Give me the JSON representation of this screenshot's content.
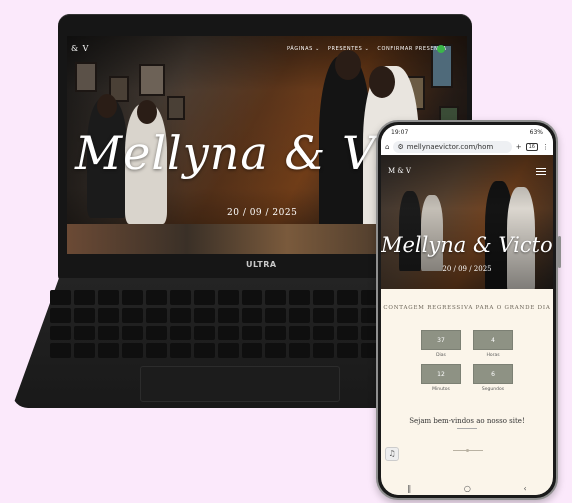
{
  "laptop": {
    "logo": "& V",
    "nav": [
      "PÁGINAS",
      "PRESENTES",
      "CONFIRMAR PRESENÇA"
    ],
    "hero_title": "Mellyna & Victor",
    "hero_date": "20 / 09 / 2025",
    "brand": "ULTRA"
  },
  "phone": {
    "status": {
      "time": "19:07",
      "battery": "63%"
    },
    "url": "mellynaevictor.com/hom",
    "tab_count": "16",
    "logo": "M & V",
    "hero_title": "Mellyna & Victor",
    "hero_date": "20 / 09 / 2025",
    "countdown_title": "CONTAGEM REGRESSIVA PARA O GRANDE DIA",
    "countdown": [
      {
        "value": "37",
        "label": "Dias"
      },
      {
        "value": "4",
        "label": "Horas"
      },
      {
        "value": "12",
        "label": "Minutos"
      },
      {
        "value": "6",
        "label": "Segundos"
      }
    ],
    "welcome": "Sejam bem-vindos ao nosso site!"
  },
  "colors": {
    "background": "#fbe9fb",
    "phone_page_bg": "#fbf5ea",
    "countdown_box": "#8e9284"
  }
}
